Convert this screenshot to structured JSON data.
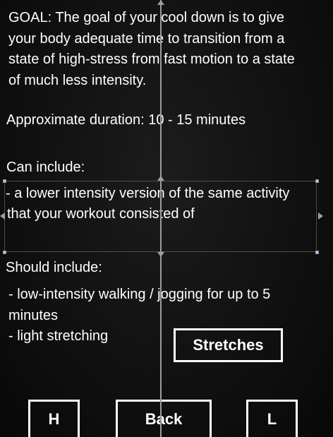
{
  "goal": {
    "lines": [
      "GOAL: The goal of your cool down is to give",
      "your body adequate time to transition from a",
      "state of high-stress from fast motion to a state",
      "of much less intensity."
    ]
  },
  "duration": {
    "text": "Approximate duration:  10 - 15 minutes"
  },
  "can_include": {
    "heading": "Can include:",
    "lines": [
      "- a lower intensity version of the same activity",
      "that your workout consisted of"
    ]
  },
  "should_include": {
    "heading": "Should include:",
    "lines": [
      "- low-intensity walking / jogging for up to 5",
      "minutes",
      "- light stretching"
    ]
  },
  "buttons": {
    "stretches": "Stretches",
    "h": "H",
    "back": "Back",
    "l": "L"
  },
  "colors": {
    "background": "#111111",
    "text": "#ffffff",
    "selection_border": "#5c4a3c",
    "guide": "#9c9c9c"
  }
}
